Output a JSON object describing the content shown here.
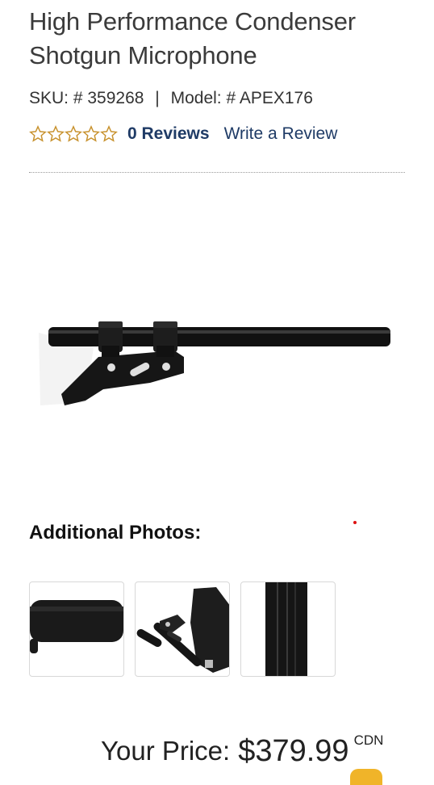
{
  "product": {
    "title_line1": "High Performance Condenser",
    "title_line2": "Shotgun Microphone",
    "sku_label": "SKU: # 359268",
    "separator": "|",
    "model_label": "Model: # APEX176",
    "rating_stars": 0,
    "reviews_label": "0 Reviews",
    "write_review_label": "Write a Review"
  },
  "gallery": {
    "heading": "Additional Photos:",
    "thumbnails": [
      "foam-windscreen-icon",
      "kit-contents-icon",
      "microphone-tube-icon"
    ]
  },
  "price": {
    "label": "Your Price:",
    "amount": "$379.99",
    "currency": "CDN"
  },
  "colors": {
    "link": "#1f3b66",
    "star_outline": "#c8922e",
    "accent_red": "#dd1111"
  }
}
